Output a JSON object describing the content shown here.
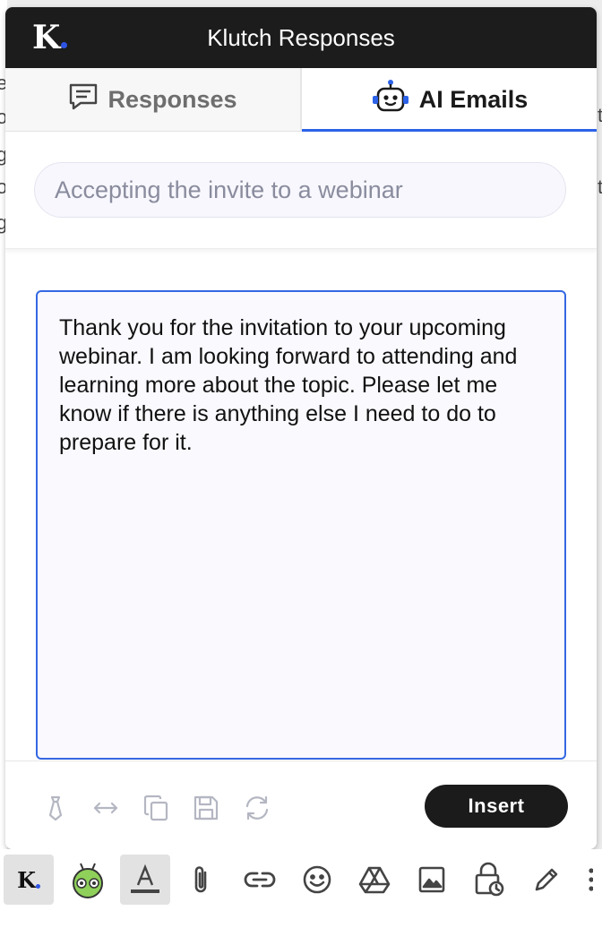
{
  "background": {
    "left_fragments": [
      "e",
      "o",
      "g",
      "o",
      "g"
    ],
    "right_fragments": [
      "t",
      "t"
    ]
  },
  "header": {
    "logo_text": "K",
    "title": "Klutch Responses"
  },
  "tabs": [
    {
      "label": "Responses",
      "icon": "chat-bubble-icon",
      "active": false
    },
    {
      "label": "AI Emails",
      "icon": "robot-icon",
      "active": true
    }
  ],
  "prompt": {
    "value": "Accepting the invite to a webinar"
  },
  "editor": {
    "text": "Thank you for the invitation to your upcoming webinar. I am looking forward to attending and learning more about the topic. Please let me know if there is anything else I need to do to prepare for it."
  },
  "footer": {
    "tools": [
      "tie-icon",
      "resize-arrows-icon",
      "copy-icon",
      "save-icon",
      "refresh-icon"
    ],
    "insert_label": "Insert"
  },
  "gmail_toolbar": {
    "logo_text": "K",
    "icons": [
      "klutch-logo-icon",
      "android-bot-icon",
      "text-format-icon",
      "attachment-icon",
      "link-icon",
      "emoji-icon",
      "drive-icon",
      "image-icon",
      "confidential-lock-icon",
      "signature-pen-icon",
      "more-icon"
    ]
  },
  "colors": {
    "accent": "#2c62e8",
    "dark": "#1b1b1b",
    "logo_dot": "#2d55e6"
  }
}
